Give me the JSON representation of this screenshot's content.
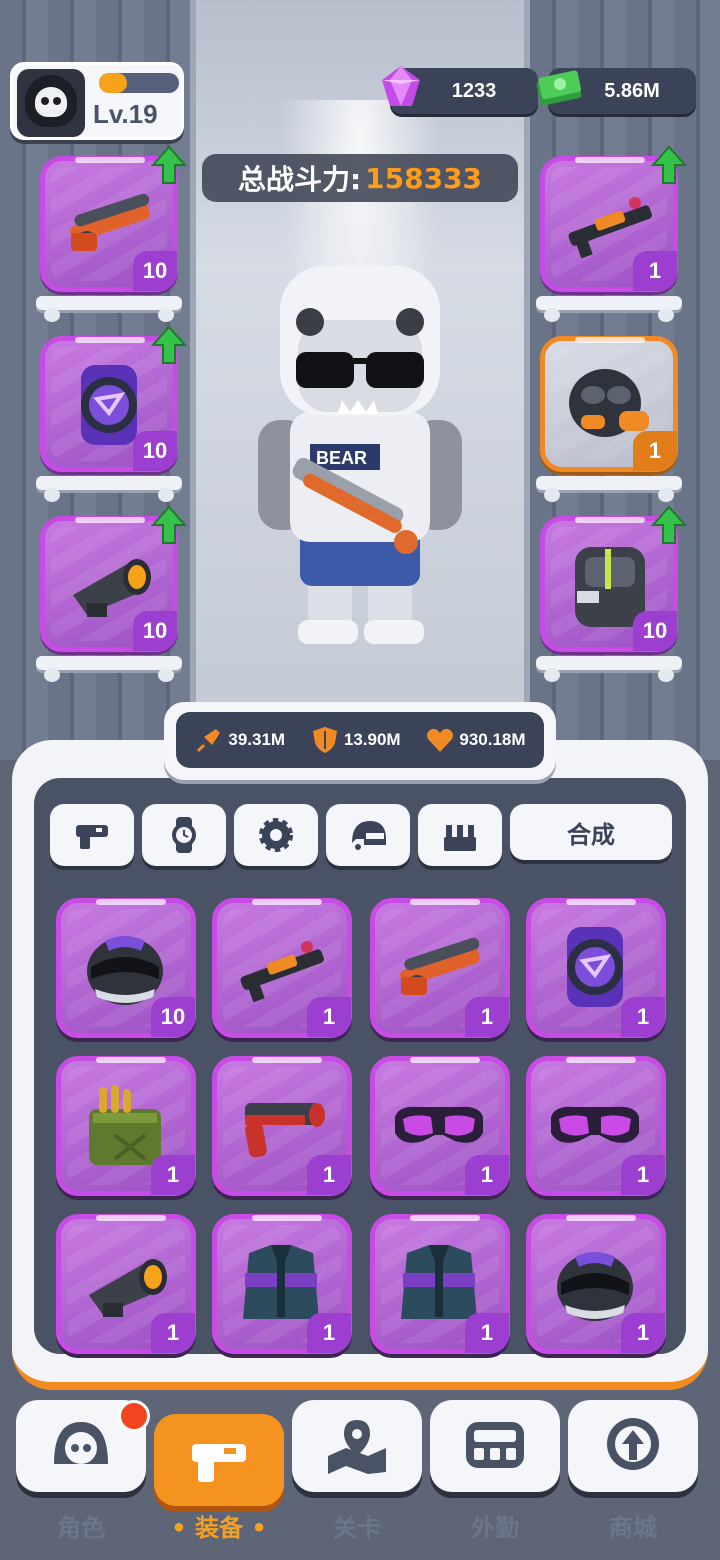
{
  "player": {
    "level": "Lv.19",
    "xp_fraction": 0.35
  },
  "currency": {
    "gems": "1233",
    "cash": "5.86M"
  },
  "power": {
    "label": "总战斗力:",
    "value": "158333"
  },
  "character": {
    "shirt_text": "BEAR"
  },
  "equipped_left": [
    {
      "icon": "shotgun-icon",
      "count": "10",
      "upgrade": true
    },
    {
      "icon": "watch-icon",
      "count": "10",
      "upgrade": true
    },
    {
      "icon": "scope-icon",
      "count": "10",
      "upgrade": true
    }
  ],
  "equipped_right": [
    {
      "icon": "rifle-icon",
      "count": "1",
      "upgrade": true,
      "rarity": "purple"
    },
    {
      "icon": "gas-mask-icon",
      "count": "1",
      "upgrade": false,
      "rarity": "orange"
    },
    {
      "icon": "backpack-icon",
      "count": "10",
      "upgrade": true,
      "rarity": "purple"
    }
  ],
  "stats": {
    "attack": "39.31M",
    "defense": "13.90M",
    "health": "930.18M"
  },
  "tabs": [
    "gun-tab-icon",
    "watch-tab-icon",
    "gear-tab-icon",
    "helmet-tab-icon",
    "armor-tab-icon"
  ],
  "merge_label": "合成",
  "inventory": [
    {
      "icon": "helmet-icon",
      "count": "10"
    },
    {
      "icon": "rifle-icon",
      "count": "1"
    },
    {
      "icon": "shotgun-icon",
      "count": "1"
    },
    {
      "icon": "watch-icon",
      "count": "1"
    },
    {
      "icon": "ammo-box-icon",
      "count": "1"
    },
    {
      "icon": "pistol-icon",
      "count": "1"
    },
    {
      "icon": "goggles-icon",
      "count": "1"
    },
    {
      "icon": "goggles-icon",
      "count": "1"
    },
    {
      "icon": "scope-icon",
      "count": "1"
    },
    {
      "icon": "vest-icon",
      "count": "1"
    },
    {
      "icon": "vest-icon",
      "count": "1"
    },
    {
      "icon": "helmet-icon",
      "count": "1"
    }
  ],
  "nav": [
    {
      "label": "角色",
      "icon": "character-nav-icon",
      "active": false,
      "badge": true
    },
    {
      "label": "装备",
      "icon": "equipment-nav-icon",
      "active": true,
      "badge": false
    },
    {
      "label": "关卡",
      "icon": "map-nav-icon",
      "active": false,
      "badge": false
    },
    {
      "label": "外勤",
      "icon": "field-nav-icon",
      "active": false,
      "badge": false
    },
    {
      "label": "商城",
      "icon": "shop-nav-icon",
      "active": false,
      "badge": false
    }
  ],
  "colors": {
    "accent": "#f59320",
    "rarity_purple": "#c84be6",
    "rarity_orange": "#f08a24",
    "power_value": "#ff9d1a"
  }
}
